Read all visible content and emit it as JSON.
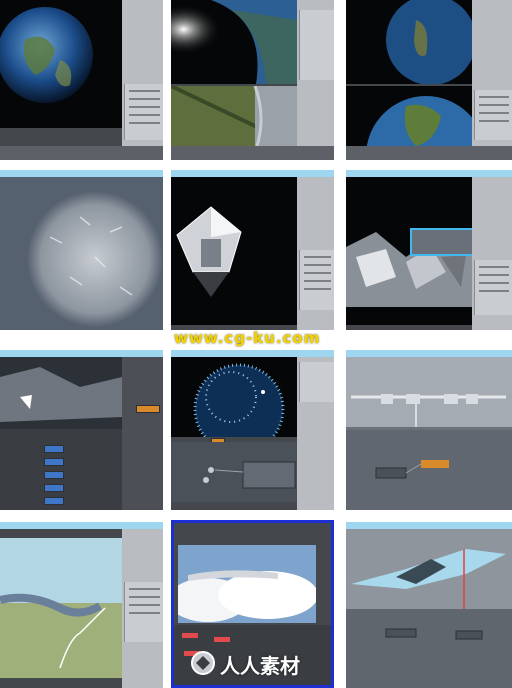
{
  "watermark": {
    "text": "www.cg-ku.com",
    "color": "#f2d300"
  },
  "brand": {
    "text": "人人素材",
    "icon": "circle-logo-icon"
  },
  "tiles": [
    {
      "name": "earth-render-tile"
    },
    {
      "name": "earth-horizon-tile"
    },
    {
      "name": "earth-split-view-tile"
    },
    {
      "name": "debris-sphere-tile"
    },
    {
      "name": "glass-polyhedron-tile"
    },
    {
      "name": "shattered-fragments-tile"
    },
    {
      "name": "fragment-node-editor-tile"
    },
    {
      "name": "particle-globe-tile"
    },
    {
      "name": "aircraft-wireframe-tile"
    },
    {
      "name": "aircraft-landscape-tile"
    },
    {
      "name": "aircraft-clouds-tile"
    },
    {
      "name": "aircraft-closeup-tile"
    }
  ],
  "colors": {
    "titlebar": "#9fd6ef",
    "panel": "#c9ccd0",
    "active_border": "#1d2fd1"
  }
}
